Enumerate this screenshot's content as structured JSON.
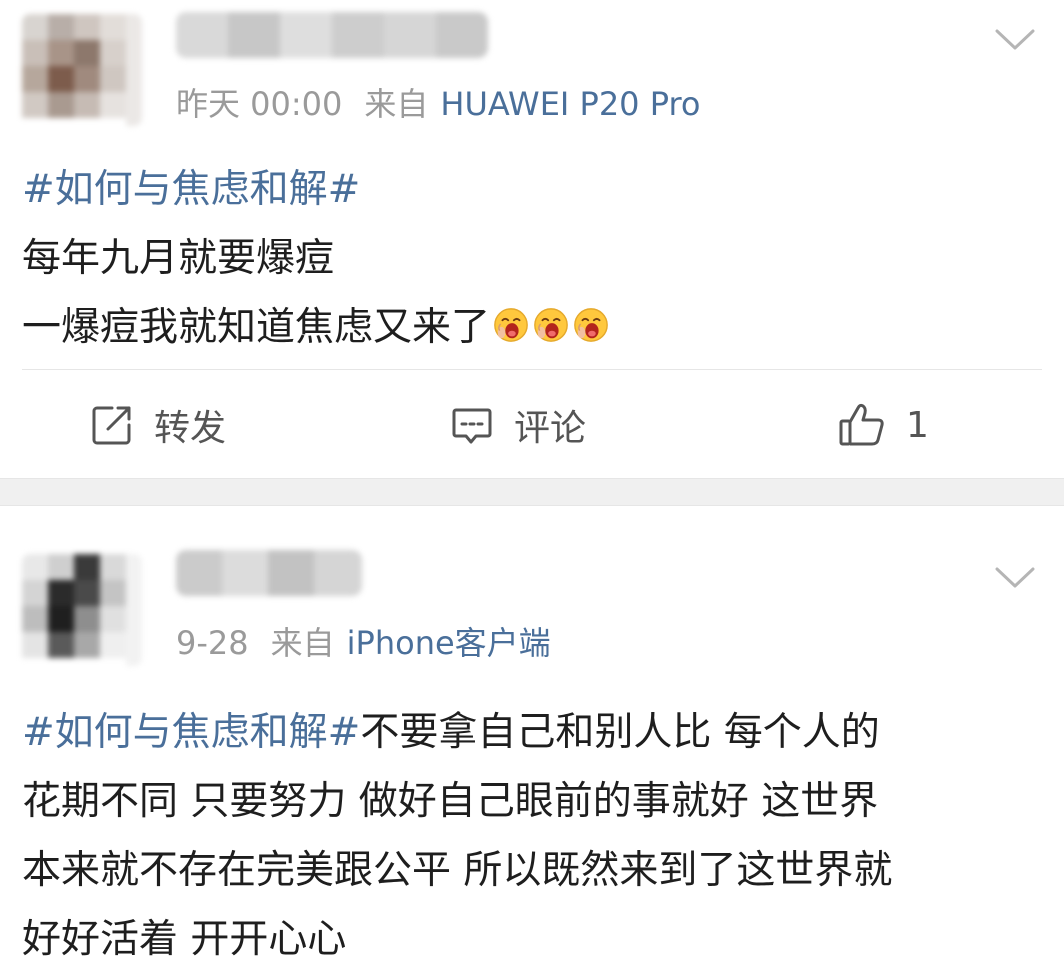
{
  "posts": [
    {
      "time": "昨天 00:00",
      "from_label": "来自",
      "device": "HUAWEI P20 Pro",
      "content_lines": [
        {
          "topic": "#如何与焦虑和解#",
          "text": ""
        },
        {
          "topic": "",
          "text": "每年九月就要爆痘"
        },
        {
          "topic": "",
          "text": "一爆痘我就知道焦虑又来了"
        }
      ],
      "emoji": "crying-face-emoji",
      "actions": {
        "repost_label": "转发",
        "comment_label": "评论",
        "like_count": "1"
      }
    },
    {
      "time": "9-28",
      "from_label": "来自",
      "device": "iPhone客户端",
      "content_lines": [
        {
          "topic": "#如何与焦虑和解#",
          "text": "不要拿自己和别人比 每个人的"
        },
        {
          "topic": "",
          "text": "花期不同 只要努力 做好自己眼前的事就好 这世界"
        },
        {
          "topic": "",
          "text": "本来就不存在完美跟公平 所以既然来到了这世界就"
        },
        {
          "topic": "",
          "text": "好好活着 开开心心"
        }
      ]
    }
  ],
  "colors": {
    "link": "#4a6f9a",
    "meta": "#9a9a9a",
    "text": "#1e1e1e",
    "separator": "#f0f0f0"
  }
}
